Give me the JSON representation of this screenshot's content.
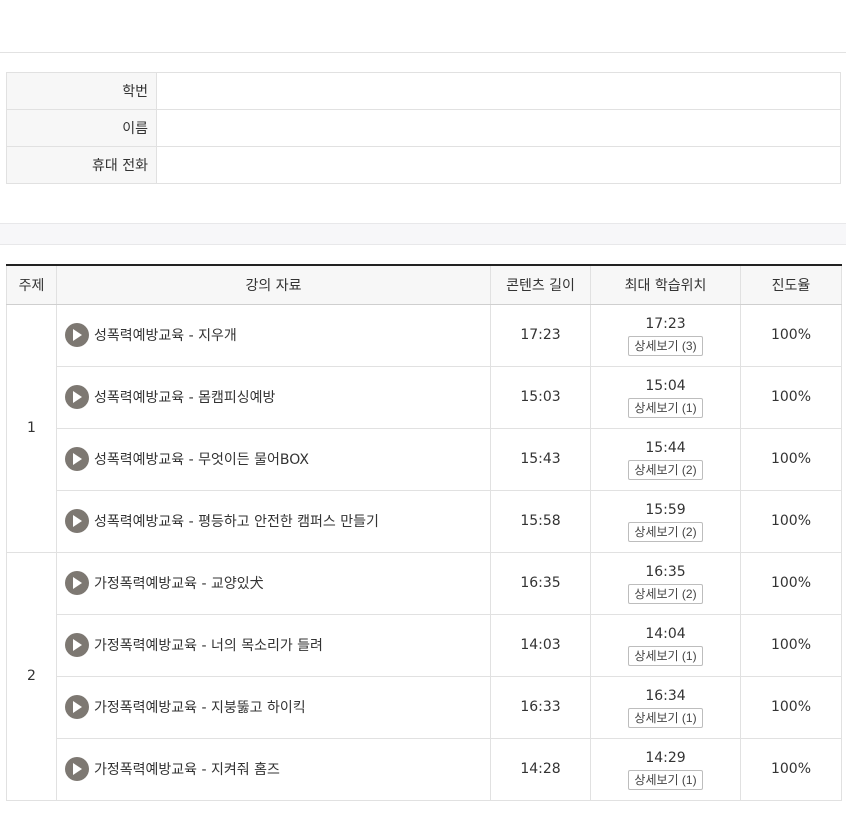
{
  "student_info": {
    "rows": [
      {
        "label": "학번",
        "value": ""
      },
      {
        "label": "이름",
        "value": ""
      },
      {
        "label": "휴대 전화",
        "value": ""
      }
    ]
  },
  "lecture_table": {
    "headers": [
      "주제",
      "강의 자료",
      "콘텐츠 길이",
      "최대 학습위치",
      "진도율"
    ],
    "topics": [
      {
        "label": "1",
        "items": [
          {
            "title": "성폭력예방교육 - 지우개",
            "length": "17:23",
            "max_position": "17:23",
            "detail": "상세보기 (3)",
            "progress": "100%"
          },
          {
            "title": "성폭력예방교육 - 몸캠피싱예방",
            "length": "15:03",
            "max_position": "15:04",
            "detail": "상세보기 (1)",
            "progress": "100%"
          },
          {
            "title": "성폭력예방교육 - 무엇이든 물어BOX",
            "length": "15:43",
            "max_position": "15:44",
            "detail": "상세보기 (2)",
            "progress": "100%"
          },
          {
            "title": "성폭력예방교육 - 평등하고 안전한 캠퍼스 만들기",
            "length": "15:58",
            "max_position": "15:59",
            "detail": "상세보기 (2)",
            "progress": "100%"
          }
        ]
      },
      {
        "label": "2",
        "items": [
          {
            "title": "가정폭력예방교육 - 교양있犬",
            "length": "16:35",
            "max_position": "16:35",
            "detail": "상세보기 (2)",
            "progress": "100%"
          },
          {
            "title": "가정폭력예방교육 - 너의 목소리가 들려",
            "length": "14:03",
            "max_position": "14:04",
            "detail": "상세보기 (1)",
            "progress": "100%"
          },
          {
            "title": "가정폭력예방교육 - 지붕뚫고 하이킥",
            "length": "16:33",
            "max_position": "16:34",
            "detail": "상세보기 (1)",
            "progress": "100%"
          },
          {
            "title": "가정폭력예방교육 - 지켜줘 홈즈",
            "length": "14:28",
            "max_position": "14:29",
            "detail": "상세보기 (1)",
            "progress": "100%"
          }
        ]
      }
    ]
  },
  "icons": {
    "play": "play-circle-icon"
  },
  "colors": {
    "play_icon_bg": "#7d7872",
    "header_border": "#222222",
    "header_bg": "#f7f7f7"
  }
}
